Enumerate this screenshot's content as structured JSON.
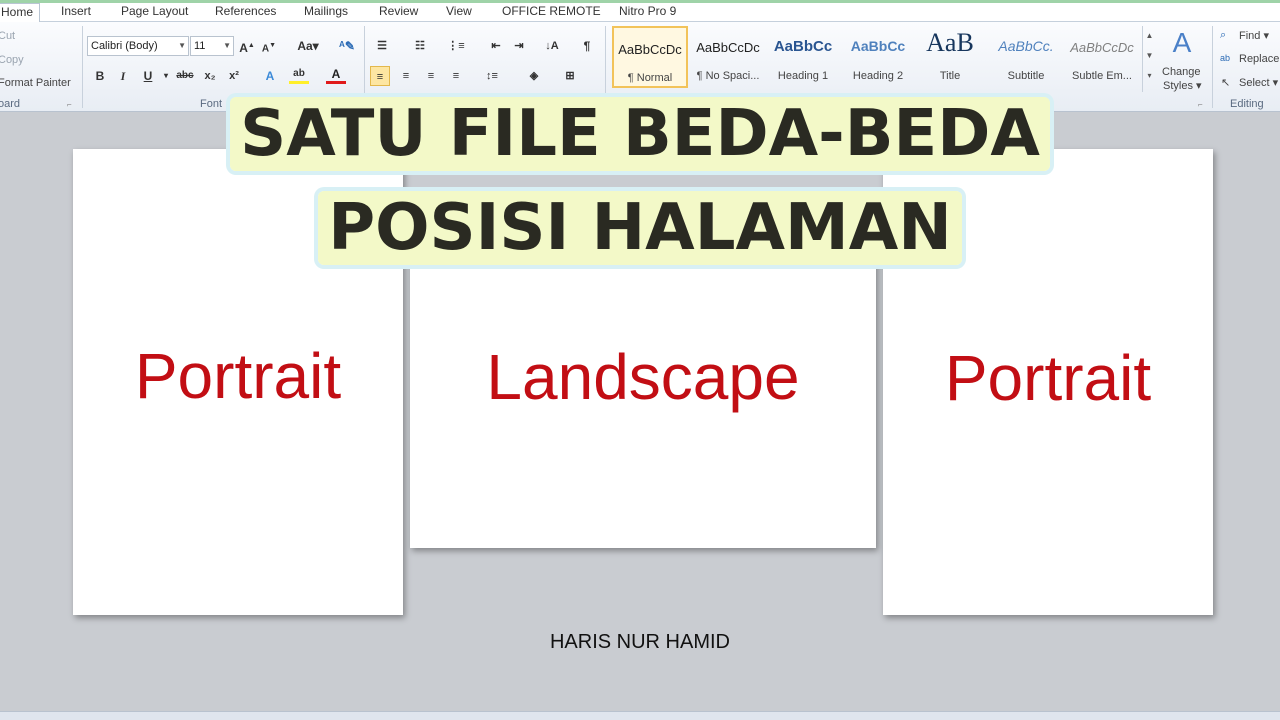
{
  "tabs": [
    "Home",
    "Insert",
    "Page Layout",
    "References",
    "Mailings",
    "Review",
    "View",
    "OFFICE REMOTE",
    "Nitro Pro 9"
  ],
  "clipboard": {
    "cut": "Cut",
    "copy": "Copy",
    "format_painter": "Format Painter",
    "label": "oard"
  },
  "font": {
    "family": "Calibri (Body)",
    "size": "11",
    "label": "Font"
  },
  "styles": [
    {
      "preview": "AaBbCcDc",
      "name": "¶ Normal"
    },
    {
      "preview": "AaBbCcDc",
      "name": "¶ No Spaci..."
    },
    {
      "preview": "AaBbCc",
      "name": "Heading 1"
    },
    {
      "preview": "AaBbCc",
      "name": "Heading 2"
    },
    {
      "preview": "AaB",
      "name": "Title"
    },
    {
      "preview": "AaBbCc.",
      "name": "Subtitle"
    },
    {
      "preview": "AaBbCcDc",
      "name": "Subtle Em..."
    }
  ],
  "change_styles": {
    "line1": "Change",
    "line2": "Styles ▾"
  },
  "editing": {
    "find": "Find ▾",
    "replace": "Replace",
    "select": "Select ▾",
    "label": "Editing"
  },
  "overlay": {
    "line1": "SATU FILE BEDA-BEDA",
    "line2": "POSISI HALAMAN"
  },
  "pages": {
    "left": "Portrait",
    "middle": "Landscape",
    "right": "Portrait"
  },
  "author": "HARIS NUR HAMID",
  "colors": {
    "page_text": "#c20e14",
    "title_text": "#2a2a22",
    "title_bg": "#f3f9c8"
  }
}
